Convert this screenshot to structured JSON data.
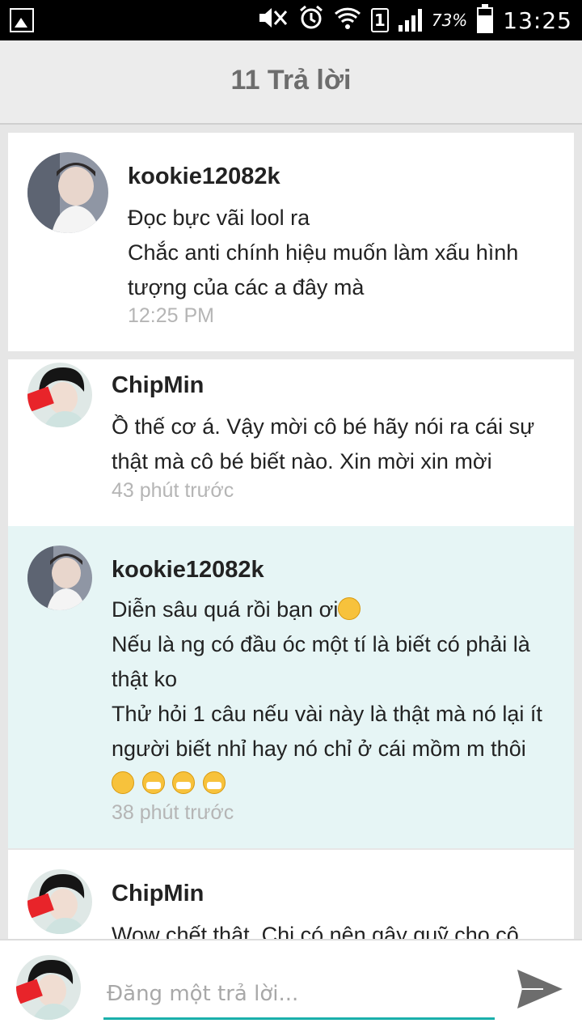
{
  "status_bar": {
    "battery_pct": "73%",
    "time": "13:25",
    "sim_label": "1",
    "icons": [
      "gallery-icon",
      "mute-icon",
      "alarm-icon",
      "wifi-icon",
      "sim-icon",
      "signal-icon",
      "battery-icon"
    ]
  },
  "header": {
    "title": "11 Trả lời"
  },
  "comments": [
    {
      "author": "kookie12082k",
      "lines": [
        "Đọc bực vãi lool ra",
        "Chắc anti chính hiệu muốn làm xấu hình",
        "tượng của các a đây mà"
      ],
      "time": "12:25 PM",
      "avatar": "kookie-avatar",
      "highlighted": false
    },
    {
      "author": "ChipMin",
      "lines": [
        "Ồ thế cơ á. Vậy mời cô bé hãy nói ra cái sự",
        "thật mà cô bé biết nào. Xin mời xin mời"
      ],
      "time": "43 phút trước",
      "avatar": "chipmin-avatar",
      "highlighted": false
    },
    {
      "author": "kookie12082k",
      "lines": [
        "Diễn sâu quá rồi bạn ơi",
        "Nếu là ng có đầu óc một tí là biết có phải là",
        "thật ko",
        "Thử hỏi 1 câu nếu vài này là thật mà nó lại ít",
        "người biết nhỉ hay nó chỉ ở cái mồm m thôi"
      ],
      "time": "38 phút trước",
      "avatar": "kookie-avatar",
      "highlighted": true,
      "emoji_after_line1": "sleepy-face-emoji",
      "emoji_row": [
        "astonished-face-emoji",
        "mask-face-emoji",
        "mask-face-emoji",
        "mask-face-emoji"
      ]
    },
    {
      "author": "ChipMin",
      "lines": [
        "Wow chết thật. Chị có nên gây quỹ cho cô"
      ],
      "avatar": "chipmin-avatar",
      "highlighted": false
    }
  ],
  "composer": {
    "placeholder": "Đăng một trả lời...",
    "value": ""
  },
  "colors": {
    "accent": "#1ab0ab",
    "highlight_bg": "#e6f5f5",
    "timestamp": "#b5b5b5"
  }
}
